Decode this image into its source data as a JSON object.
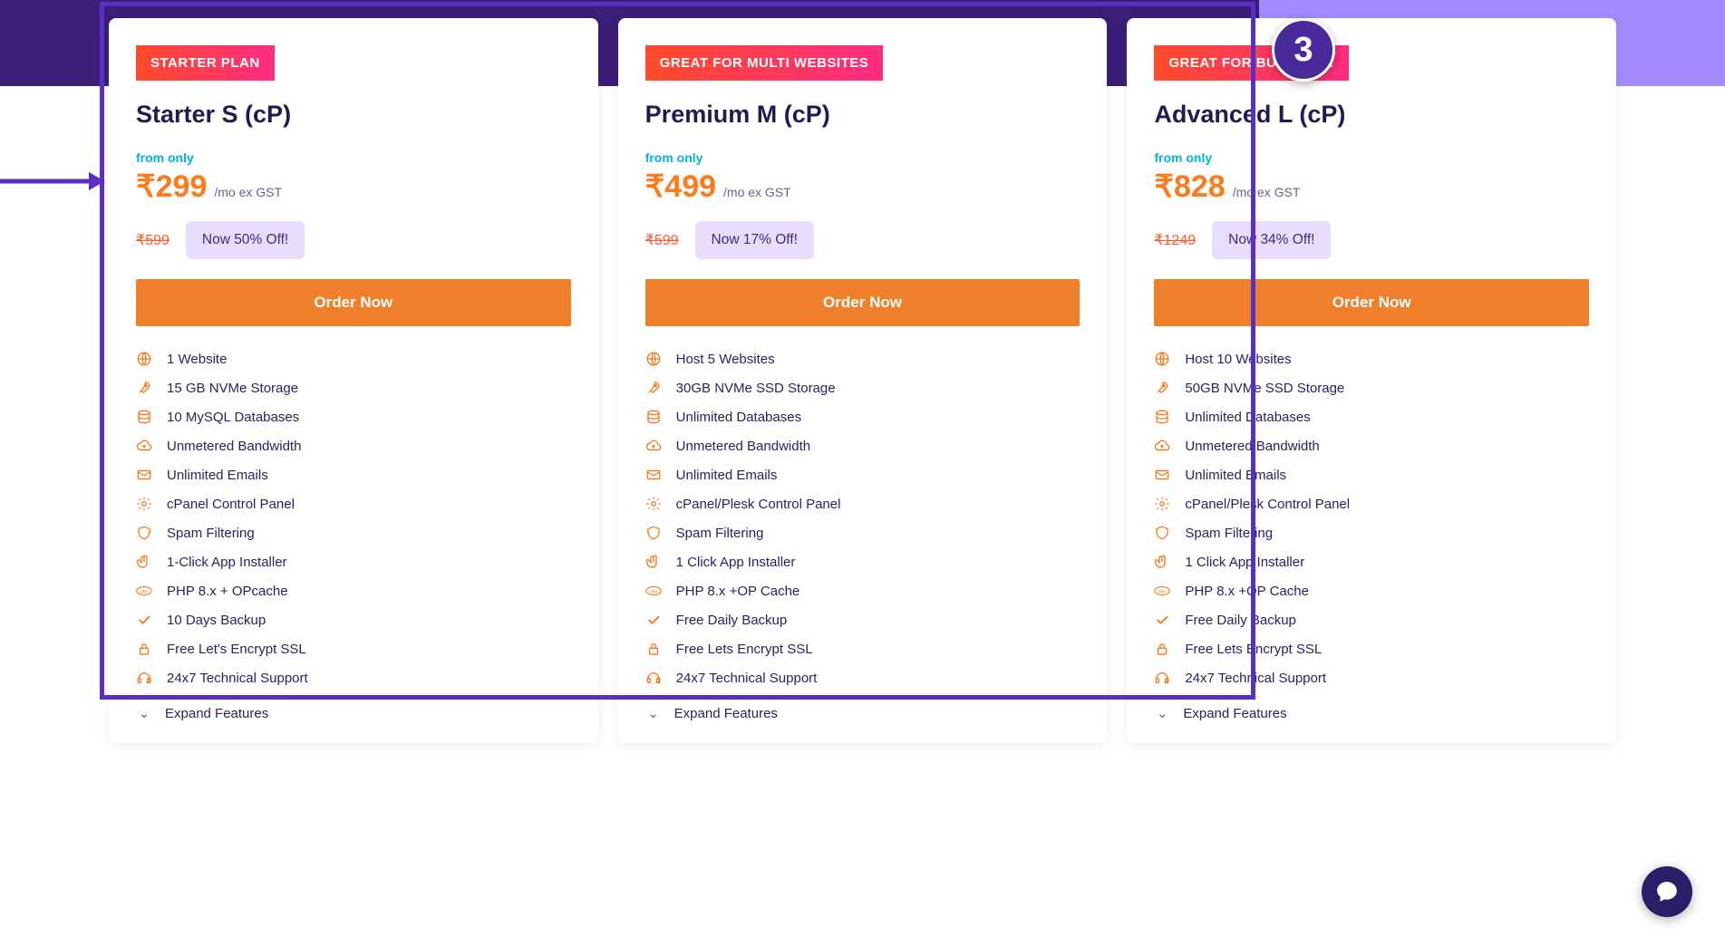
{
  "step_badge": "3",
  "order_now_label": "Order Now",
  "from_only_label": "from only",
  "per_label": "/mo ex GST",
  "expand_label": "Expand Features",
  "plans": [
    {
      "tag": "STARTER PLAN",
      "name": "Starter S (cP)",
      "price": "₹299",
      "strike": "₹599",
      "discount": "Now 50% Off!",
      "features": [
        "1 Website",
        "15 GB NVMe Storage",
        "10 MySQL Databases",
        "Unmetered Bandwidth",
        "Unlimited Emails",
        "cPanel Control Panel",
        "Spam Filtering",
        "1-Click App Installer",
        "PHP 8.x + OPcache",
        "10 Days Backup",
        "Free Let's Encrypt SSL",
        "24x7 Technical Support"
      ]
    },
    {
      "tag": "GREAT FOR MULTI WEBSITES",
      "name": "Premium M (cP)",
      "price": "₹499",
      "strike": "₹599",
      "discount": "Now 17% Off!",
      "features": [
        "Host 5 Websites",
        "30GB NVMe SSD Storage",
        "Unlimited Databases",
        "Unmetered Bandwidth",
        "Unlimited Emails",
        "cPanel/Plesk Control Panel",
        "Spam Filtering",
        "1 Click App Installer",
        "PHP 8.x +OP Cache",
        "Free Daily Backup",
        "Free Lets Encrypt SSL",
        "24x7 Technical Support"
      ]
    },
    {
      "tag": "GREAT FOR BUSINESS!",
      "name": "Advanced L (cP)",
      "price": "₹828",
      "strike": "₹1249",
      "discount": "Now 34% Off!",
      "features": [
        "Host 10 Websites",
        "50GB NVMe SSD Storage",
        "Unlimited Databases",
        "Unmetered Bandwidth",
        "Unlimited Emails",
        "cPanel/Plesk Control Panel",
        "Spam Filtering",
        "1 Click App Installer",
        "PHP 8.x +OP Cache",
        "Free Daily Backup",
        "Free Lets Encrypt SSL",
        "24x7 Technical Support"
      ]
    }
  ],
  "feature_icons": [
    "globe",
    "rocket",
    "database",
    "cloud-up",
    "envelope",
    "cog",
    "shield",
    "hand",
    "php",
    "check",
    "lock",
    "headset"
  ]
}
